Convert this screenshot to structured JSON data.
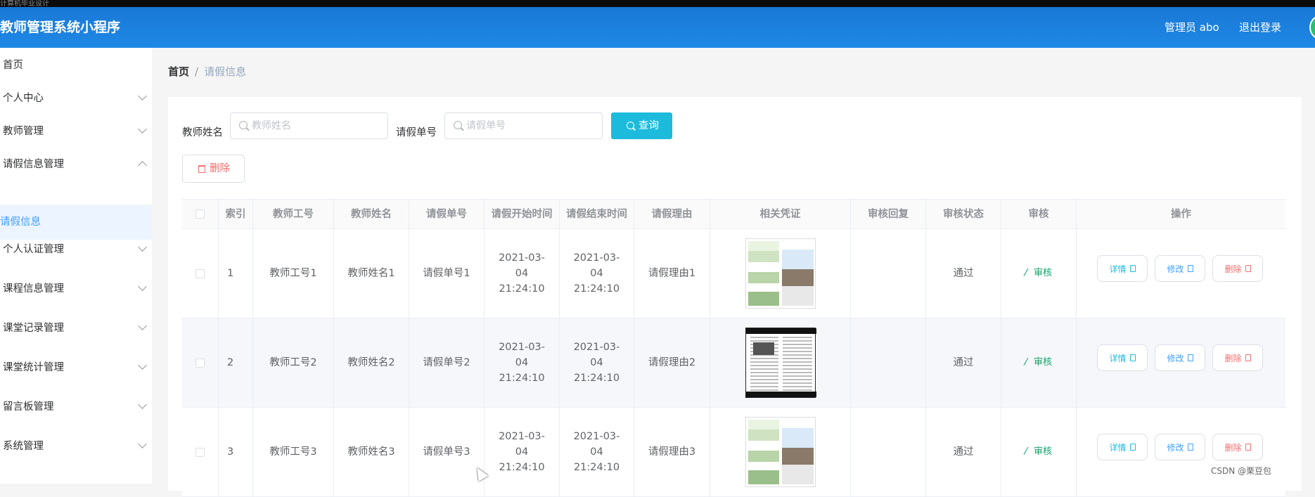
{
  "app": {
    "topstrip": "计算机毕业设计",
    "title": "教师管理系统小程序"
  },
  "header": {
    "admin_label": "管理员 abo",
    "logout_label": "退出登录"
  },
  "sidebar": {
    "items": [
      {
        "label": "首页"
      },
      {
        "label": "个人中心"
      },
      {
        "label": "教师管理"
      },
      {
        "label": "请假信息管理"
      },
      {
        "label": "请假信息"
      },
      {
        "label": "个人认证管理"
      },
      {
        "label": "课程信息管理"
      },
      {
        "label": "课堂记录管理"
      },
      {
        "label": "课堂统计管理"
      },
      {
        "label": "留言板管理"
      },
      {
        "label": "系统管理"
      }
    ]
  },
  "breadcrumb": {
    "home": "首页",
    "separator": "/",
    "current": "请假信息"
  },
  "search": {
    "teacher_name_label": "教师姓名",
    "teacher_name_placeholder": "教师姓名",
    "leave_no_label": "请假单号",
    "leave_no_placeholder": "请假单号",
    "query_label": "查询"
  },
  "toolbar": {
    "delete_label": "删除"
  },
  "table": {
    "headers": [
      "索引",
      "教师工号",
      "教师姓名",
      "请假单号",
      "请假开始时间",
      "请假结束时间",
      "请假理由",
      "相关凭证",
      "审核回复",
      "审核状态",
      "审核",
      "操作"
    ],
    "rows": [
      {
        "index": "1",
        "teacher_id": "教师工号1",
        "teacher_name": "教师姓名1",
        "leave_no": "请假单号1",
        "start": "2021-03-04 21:24:10",
        "end": "2021-03-04 21:24:10",
        "reason": "请假理由1",
        "reply": "",
        "status": "通过",
        "audit": "审核",
        "detail": "详情",
        "edit": "修改",
        "delete": "删除"
      },
      {
        "index": "2",
        "teacher_id": "教师工号2",
        "teacher_name": "教师姓名2",
        "leave_no": "请假单号2",
        "start": "2021-03-04 21:24:10",
        "end": "2021-03-04 21:24:10",
        "reason": "请假理由2",
        "reply": "",
        "status": "通过",
        "audit": "审核",
        "detail": "详情",
        "edit": "修改",
        "delete": "删除"
      },
      {
        "index": "3",
        "teacher_id": "教师工号3",
        "teacher_name": "教师姓名3",
        "leave_no": "请假单号3",
        "start": "2021-03-04 21:24:10",
        "end": "2021-03-04 21:24:10",
        "reason": "请假理由3",
        "reply": "",
        "status": "通过",
        "audit": "审核",
        "detail": "详情",
        "edit": "修改",
        "delete": "删除"
      }
    ]
  },
  "watermark": "CSDN @栗豆包",
  "colors": {
    "header": "#1e88e5",
    "accent": "#409eff",
    "query": "#1cbbdc",
    "danger": "#f56c6c",
    "success": "#13a36a"
  }
}
